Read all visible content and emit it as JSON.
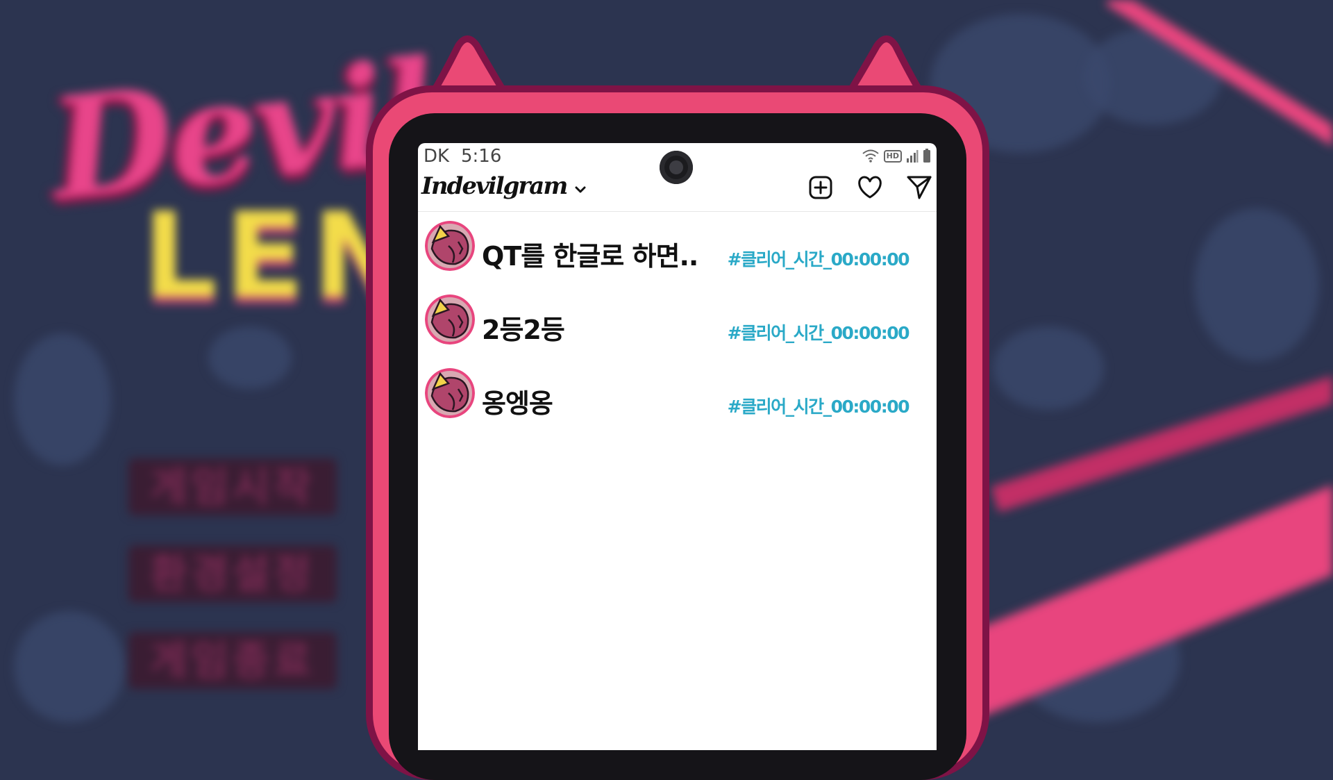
{
  "background": {
    "logo_line1": "Devil",
    "logo_line2": "LENG",
    "menu_items": [
      "게임시작",
      "환경설정",
      "게임종료"
    ]
  },
  "status_bar": {
    "carrier": "DK",
    "time": "5:16",
    "icons": [
      "wifi-icon",
      "hd-icon",
      "signal-icon",
      "battery-icon"
    ],
    "hd_label": "HD"
  },
  "header": {
    "app_name": "Indevilgram",
    "dropdown_icon": "chevron-down-icon",
    "actions": [
      "add-post-icon",
      "heart-icon",
      "send-icon"
    ]
  },
  "feed": [
    {
      "title": "QT를 한글로 하면..",
      "hashtag": "#클리어_시간_00:00:00"
    },
    {
      "title": "2등2등",
      "hashtag": "#클리어_시간_00:00:00"
    },
    {
      "title": "옹엥옹",
      "hashtag": "#클리어_시간_00:00:00"
    }
  ],
  "colors": {
    "phone_pink": "#ea4975",
    "phone_border": "#7e1346",
    "hashtag": "#2aa9c7",
    "background": "#2c3450"
  }
}
